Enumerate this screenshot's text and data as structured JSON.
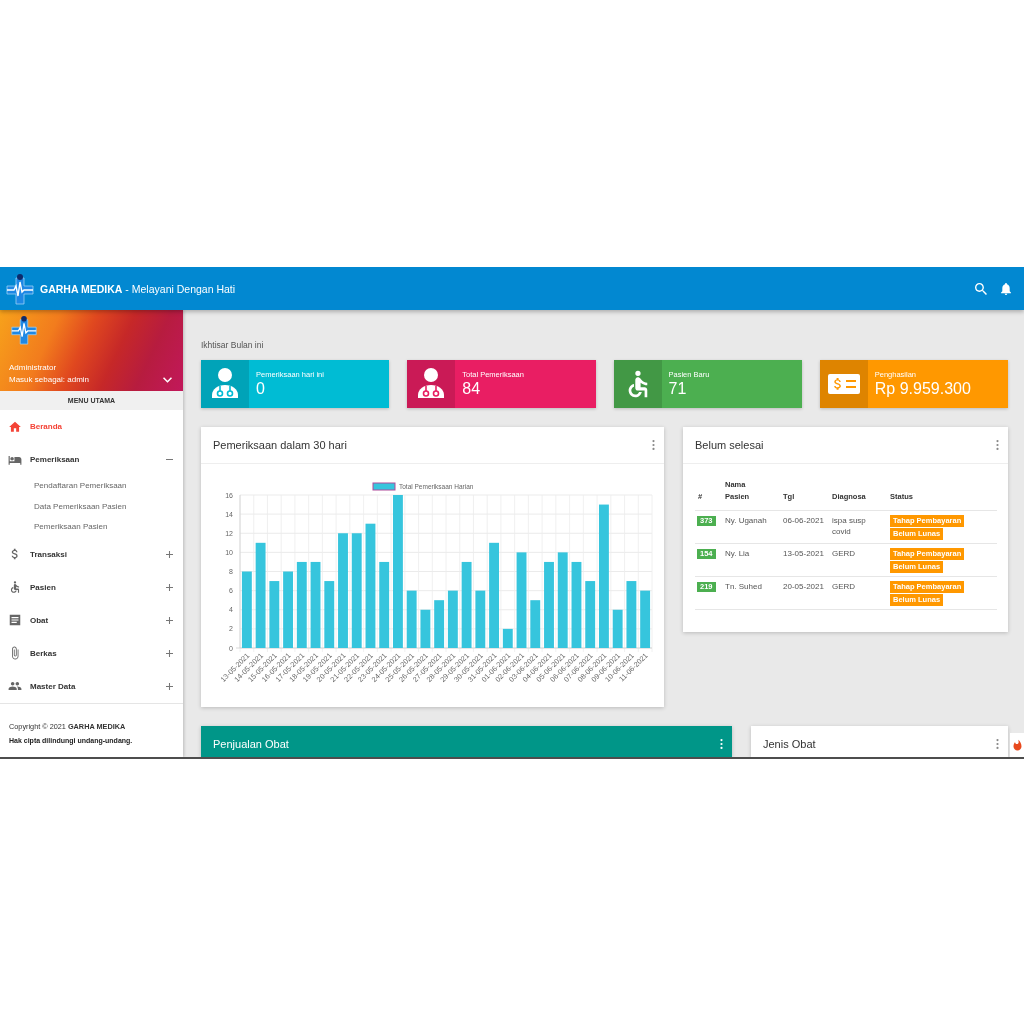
{
  "header": {
    "title": "**GARHA MEDIKA** - Melayani Dengan Hati"
  },
  "profile": {
    "name": "Administrator",
    "role": "Masuk sebagai: admin"
  },
  "sidebar": {
    "heading": "MENU UTAMA",
    "items": [
      {
        "label": "Beranda",
        "kind": "link",
        "selected": true
      },
      {
        "label": "Pemeriksaan",
        "kind": "group",
        "selected": false,
        "expanded": true,
        "children": [
          {
            "label": "Pendaftaran Pemeriksaan",
            "selected": false
          },
          {
            "label": "Data Pemeriksaan Pasien",
            "selected": false
          },
          {
            "label": "Pemeriksaan Pasien",
            "selected": false
          }
        ]
      },
      {
        "label": "Transaksi",
        "kind": "group",
        "selected": false,
        "expanded": false
      },
      {
        "label": "Pasien",
        "kind": "group",
        "selected": false,
        "expanded": false
      },
      {
        "label": "Obat",
        "kind": "group",
        "selected": false,
        "expanded": false
      },
      {
        "label": "Berkas",
        "kind": "group",
        "selected": false,
        "expanded": false
      },
      {
        "label": "Master Data",
        "kind": "group",
        "selected": false,
        "expanded": false
      }
    ],
    "footer": {
      "copyright": "Copyright © 2021 **GARHA MEDIKA**",
      "notice": "Hak cipta dilindungi undang-undang."
    }
  },
  "overview": {
    "title": "Ikhtisar Bulan ini",
    "stats": [
      {
        "label": "Pemeriksaan hari ini",
        "value": "0",
        "color": "#00bcd4"
      },
      {
        "label": "Total Pemeriksaan",
        "value": "84",
        "color": "#e91e63"
      },
      {
        "label": "Pasien Baru",
        "value": "71",
        "color": "#4caf50"
      },
      {
        "label": "Penghasilan",
        "value": "Rp 9.959.300",
        "color": "#ff9800"
      }
    ]
  },
  "chart_card": {
    "title": "Pemeriksaan dalam 30 hari",
    "chart_data": {
      "type": "bar",
      "grid": true,
      "categories": [
        "13-05-2021",
        "14-05-2021",
        "15-05-2021",
        "16-05-2021",
        "17-05-2021",
        "18-05-2021",
        "19-05-2021",
        "20-05-2021",
        "21-05-2021",
        "22-05-2021",
        "23-05-2021",
        "24-05-2021",
        "25-05-2021",
        "26-05-2021",
        "27-05-2021",
        "28-05-2021",
        "29-05-2021",
        "30-05-2021",
        "31-05-2021",
        "01-06-2021",
        "02-06-2021",
        "03-06-2021",
        "04-06-2021",
        "05-06-2021",
        "06-06-2021",
        "07-06-2021",
        "08-06-2021",
        "09-06-2021",
        "10-06-2021",
        "11-06-2021"
      ],
      "series": [
        {
          "name": "Total Pemeriksaan Harian",
          "color": "#36c5dd",
          "values": [
            8,
            11,
            7,
            8,
            9,
            9,
            7,
            12,
            12,
            13,
            9,
            16,
            6,
            4,
            5,
            6,
            9,
            6,
            11,
            2,
            10,
            5,
            9,
            10,
            9,
            7,
            15,
            4,
            7,
            6
          ]
        }
      ],
      "ylim": [
        0,
        16
      ],
      "yticks": [
        0,
        2,
        4,
        6,
        8,
        10,
        12,
        14,
        16
      ]
    }
  },
  "pending": {
    "title": "Belum selesai",
    "columns": [
      "#",
      "Nama Pasien",
      "Tgl",
      "Diagnosa",
      "Status"
    ],
    "rows": [
      {
        "id": "373",
        "name": "Ny. Uganah",
        "date": "06-06-2021",
        "diagnosis": "ispa susp covid",
        "statuses": [
          "Tahap Pembayaran",
          "Belum Lunas"
        ]
      },
      {
        "id": "154",
        "name": "Ny. Lia",
        "date": "13-05-2021",
        "diagnosis": "GERD",
        "statuses": [
          "Tahap Pembayaran",
          "Belum Lunas"
        ]
      },
      {
        "id": "219",
        "name": "Tn. Suhed",
        "date": "20-05-2021",
        "diagnosis": "GERD",
        "statuses": [
          "Tahap Pembayaran",
          "Belum Lunas"
        ]
      }
    ]
  },
  "bottom_cards": [
    {
      "title": "Penjualan Obat",
      "kind": "accent"
    },
    {
      "title": "Jenis Obat",
      "kind": "plain"
    }
  ]
}
